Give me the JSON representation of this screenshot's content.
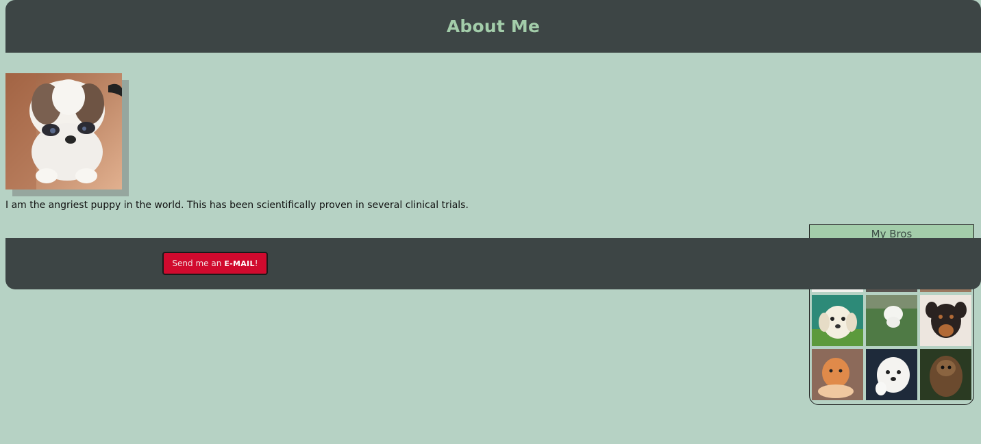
{
  "header": {
    "title": "About Me"
  },
  "profile": {
    "photo_alt": "angry puppy",
    "bio": "I am the angriest puppy in the world. This has been scientifically proven in several clinical trials."
  },
  "bros": {
    "title": "My Bros",
    "items": [
      {
        "name": "puppy-1"
      },
      {
        "name": "puppy-2"
      },
      {
        "name": "puppy-3"
      },
      {
        "name": "puppy-4"
      },
      {
        "name": "puppy-5"
      },
      {
        "name": "puppy-6"
      },
      {
        "name": "puppy-7"
      },
      {
        "name": "puppy-8"
      },
      {
        "name": "puppy-9"
      }
    ]
  },
  "footer": {
    "email_prefix": "Send me an",
    "email_strong": "E-MAIL",
    "email_suffix": "!"
  },
  "colors": {
    "background": "#b6d2c4",
    "bar": "#3d4545",
    "accent": "#a3cdaa",
    "button": "#d10a2e"
  }
}
